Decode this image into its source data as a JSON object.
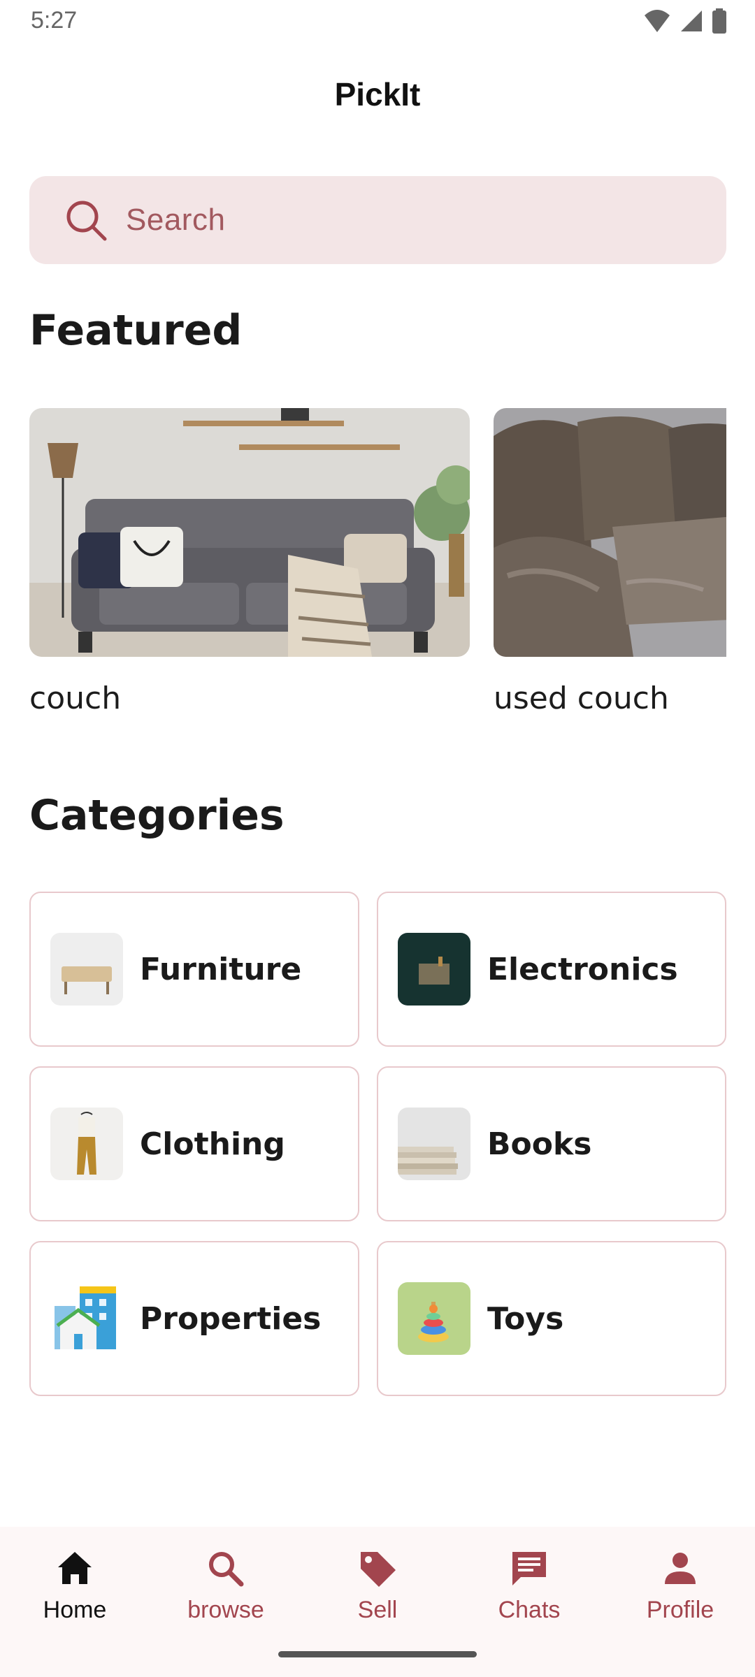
{
  "status_bar": {
    "time": "5:27"
  },
  "header": {
    "title": "PickIt"
  },
  "search": {
    "placeholder": "Search"
  },
  "featured": {
    "title": "Featured",
    "items": [
      {
        "label": "couch"
      },
      {
        "label": "used couch"
      }
    ]
  },
  "categories": {
    "title": "Categories",
    "items": [
      {
        "label": "Furniture"
      },
      {
        "label": "Electronics"
      },
      {
        "label": "Clothing"
      },
      {
        "label": "Books"
      },
      {
        "label": "Properties"
      },
      {
        "label": "Toys"
      }
    ]
  },
  "bottom_nav": {
    "items": [
      {
        "label": "Home",
        "icon": "home-icon",
        "active": true
      },
      {
        "label": "browse",
        "icon": "search-icon"
      },
      {
        "label": "Sell",
        "icon": "tag-icon"
      },
      {
        "label": "Chats",
        "icon": "chat-icon"
      },
      {
        "label": "Profile",
        "icon": "person-icon"
      }
    ]
  },
  "colors": {
    "accent": "#a2454e",
    "search_bg": "#f3e5e6",
    "card_border": "#e8c9cc"
  }
}
